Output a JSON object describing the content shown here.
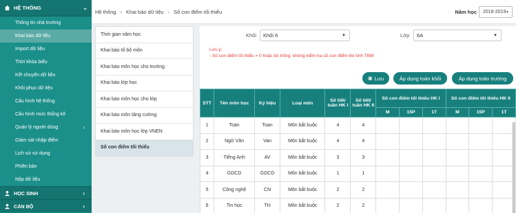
{
  "sidebar": {
    "header": "HỆ THỐNG",
    "items": [
      {
        "label": "Thông tin nhà trường",
        "active": false,
        "arrow": false
      },
      {
        "label": "Khai báo dữ liệu",
        "active": true,
        "arrow": false
      },
      {
        "label": "Import dữ liệu",
        "active": false,
        "arrow": false
      },
      {
        "label": "Thời khóa biểu",
        "active": false,
        "arrow": false
      },
      {
        "label": "Kết chuyển dữ liệu",
        "active": false,
        "arrow": false
      },
      {
        "label": "Khôi phục dữ liệu",
        "active": false,
        "arrow": false
      },
      {
        "label": "Cấu hình hệ thống",
        "active": false,
        "arrow": false
      },
      {
        "label": "Cấu hình mức thống kê",
        "active": false,
        "arrow": false
      },
      {
        "label": "Quản lý người dùng",
        "active": false,
        "arrow": true
      },
      {
        "label": "Giám sát nhập điểm",
        "active": false,
        "arrow": false
      },
      {
        "label": "Lịch sử sử dụng",
        "active": false,
        "arrow": false
      },
      {
        "label": "Phiên bản",
        "active": false,
        "arrow": false
      },
      {
        "label": "Nộp dữ liệu",
        "active": false,
        "arrow": false
      }
    ],
    "sections": [
      "HỌC SINH",
      "CÁN BỘ"
    ]
  },
  "breadcrumb": [
    "Hệ thống",
    "Khai báo dữ liệu",
    "Số con điểm tối thiểu"
  ],
  "year": {
    "label": "Năm học",
    "value": "2018-2019"
  },
  "menu": [
    {
      "label": "Thời gian năm học",
      "active": false
    },
    {
      "label": "Khai báo tổ bộ môn",
      "active": false
    },
    {
      "label": "Khai báo môn học cho trường",
      "active": false
    },
    {
      "label": "Khai báo lớp học",
      "active": false
    },
    {
      "label": "Khai báo môn học cho lớp",
      "active": false
    },
    {
      "label": "Khai báo môn tăng cường",
      "active": false
    },
    {
      "label": "Khai báo môn học lớp VNEN",
      "active": false
    },
    {
      "label": "Số con điểm tối thiểu",
      "active": true
    }
  ],
  "filters": {
    "khoi_label": "Khối",
    "khoi_value": "Khối 6",
    "lop_label": "Lớp",
    "lop_value": "6A"
  },
  "note": {
    "line1": "Lưu ý:",
    "line2": "- Số con điểm tối thiểu = 0 hoặc bỏ trống: không kiểm tra số con điểm khi tính TBM"
  },
  "buttons": {
    "save": "Lưu",
    "apply_grade": "Áp dụng toàn khối",
    "apply_school": "Áp dụng toàn trường"
  },
  "table": {
    "headers": {
      "stt": "STT",
      "mon": "Tên môn học",
      "kyhieu": "Ký hiệu",
      "loai": "Loại môn",
      "tiet1": "Số tiết/ tuần HK I",
      "tiet2": "Số tiết/ tuần HK II",
      "hk1": "Số con điểm tối thiểu HK I",
      "hk2": "Số con điểm tối thiểu HK II",
      "m": "M",
      "p15": "15P",
      "t1": "1T"
    },
    "rows": [
      {
        "stt": "1",
        "mon": "Toán",
        "kyhieu": "Toan",
        "loai": "Môn bắt buộc",
        "hk1": "4",
        "hk2": "4"
      },
      {
        "stt": "2",
        "mon": "Ngữ Văn",
        "kyhieu": "Van",
        "loai": "Môn bắt buộc",
        "hk1": "4",
        "hk2": "4"
      },
      {
        "stt": "3",
        "mon": "Tiếng Anh",
        "kyhieu": "AV",
        "loai": "Môn bắt buộc",
        "hk1": "3",
        "hk2": "3"
      },
      {
        "stt": "4",
        "mon": "GDCD",
        "kyhieu": "GDCD",
        "loai": "Môn bắt buộc",
        "hk1": "1",
        "hk2": "1"
      },
      {
        "stt": "5",
        "mon": "Công nghệ",
        "kyhieu": "CN",
        "loai": "Môn bắt buộc",
        "hk1": "2",
        "hk2": "2"
      },
      {
        "stt": "6",
        "mon": "Tin học",
        "kyhieu": "TH",
        "loai": "Môn bắt buộc",
        "hk1": "2",
        "hk2": "2"
      }
    ]
  },
  "colors": {
    "accent": "#17807d",
    "sidebar": "#1b8f8a",
    "note": "#e53935"
  }
}
